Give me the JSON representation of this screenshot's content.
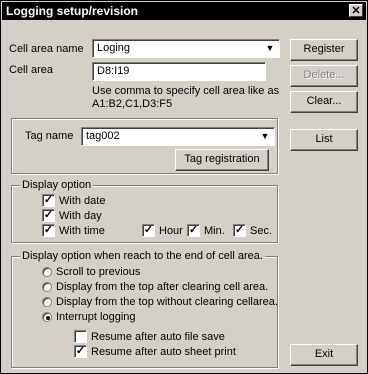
{
  "title": "Logging setup/revision",
  "close_glyph": "✕",
  "cell_area_name": {
    "label": "Cell area name",
    "value": "Loging"
  },
  "cell_area": {
    "label": "Cell area",
    "value": "D8:I19",
    "hint_line1": "Use comma to specify cell area like as",
    "hint_line2": "A1:B2,C1,D3:F5"
  },
  "buttons": {
    "register": "Register",
    "delete": "Delete...",
    "clear": "Clear...",
    "list": "List",
    "exit": "Exit"
  },
  "tag": {
    "label": "Tag name",
    "value": "tag002",
    "registration_button": "Tag registration"
  },
  "display_option": {
    "title": "Display option",
    "with_date": {
      "label": "With date",
      "checked": true
    },
    "with_day": {
      "label": "With day",
      "checked": true
    },
    "with_time": {
      "label": "With time",
      "checked": true
    },
    "hour": {
      "label": "Hour",
      "checked": true
    },
    "min": {
      "label": "Min.",
      "checked": true
    },
    "sec": {
      "label": "Sec.",
      "checked": true
    }
  },
  "end_option": {
    "title": "Display option when reach to the end of cell area.",
    "radios": [
      {
        "label": "Scroll to previous",
        "selected": false
      },
      {
        "label": "Display from the top after clearing cell area.",
        "selected": false
      },
      {
        "label": "Display from the top without clearing cellarea.",
        "selected": false
      },
      {
        "label": "Interrupt logging",
        "selected": true
      }
    ],
    "resume_file_save": {
      "label": "Resume after auto file save",
      "checked": false
    },
    "resume_sheet_print": {
      "label": "Resume after auto sheet print",
      "checked": true
    }
  },
  "check_glyph": "✓",
  "combo_arrow_glyph": "▼"
}
